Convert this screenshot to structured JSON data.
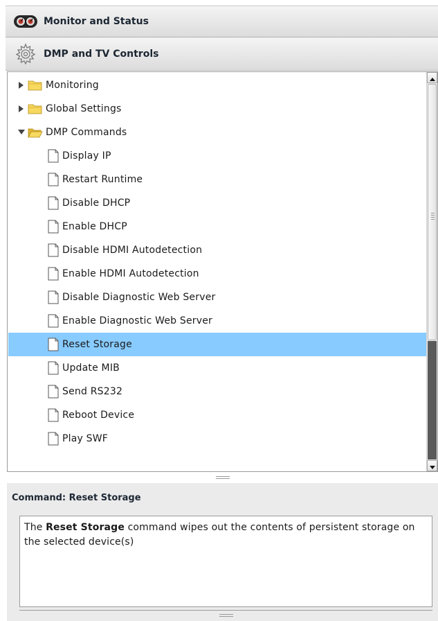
{
  "header": {
    "monitor_label": "Monitor and Status",
    "controls_label": "DMP and TV Controls"
  },
  "tree": {
    "items": [
      {
        "label": "Monitoring",
        "type": "folder",
        "expanded": false,
        "depth": 0
      },
      {
        "label": "Global Settings",
        "type": "folder",
        "expanded": false,
        "depth": 0
      },
      {
        "label": "DMP Commands",
        "type": "folder",
        "expanded": true,
        "depth": 0
      },
      {
        "label": "Display IP",
        "type": "doc",
        "depth": 1
      },
      {
        "label": "Restart Runtime",
        "type": "doc",
        "depth": 1
      },
      {
        "label": "Disable DHCP",
        "type": "doc",
        "depth": 1
      },
      {
        "label": "Enable DHCP",
        "type": "doc",
        "depth": 1
      },
      {
        "label": "Disable HDMI Autodetection",
        "type": "doc",
        "depth": 1
      },
      {
        "label": "Enable HDMI Autodetection",
        "type": "doc",
        "depth": 1
      },
      {
        "label": "Disable Diagnostic Web Server",
        "type": "doc",
        "depth": 1
      },
      {
        "label": "Enable Diagnostic Web Server",
        "type": "doc",
        "depth": 1
      },
      {
        "label": "Reset Storage",
        "type": "doc",
        "depth": 1,
        "selected": true
      },
      {
        "label": "Update MIB",
        "type": "doc",
        "depth": 1
      },
      {
        "label": "Send RS232",
        "type": "doc",
        "depth": 1
      },
      {
        "label": "Reboot Device",
        "type": "doc",
        "depth": 1
      },
      {
        "label": "Play SWF",
        "type": "doc",
        "depth": 1
      }
    ]
  },
  "description": {
    "title": "Command: Reset Storage",
    "prefix": "The ",
    "command_name": "Reset Storage",
    "suffix": " command wipes out the contents of persistent storage on the selected device(s)"
  },
  "colors": {
    "selection": "#88cbff",
    "header_text": "#1d2733",
    "folder": "#f5d34a"
  }
}
